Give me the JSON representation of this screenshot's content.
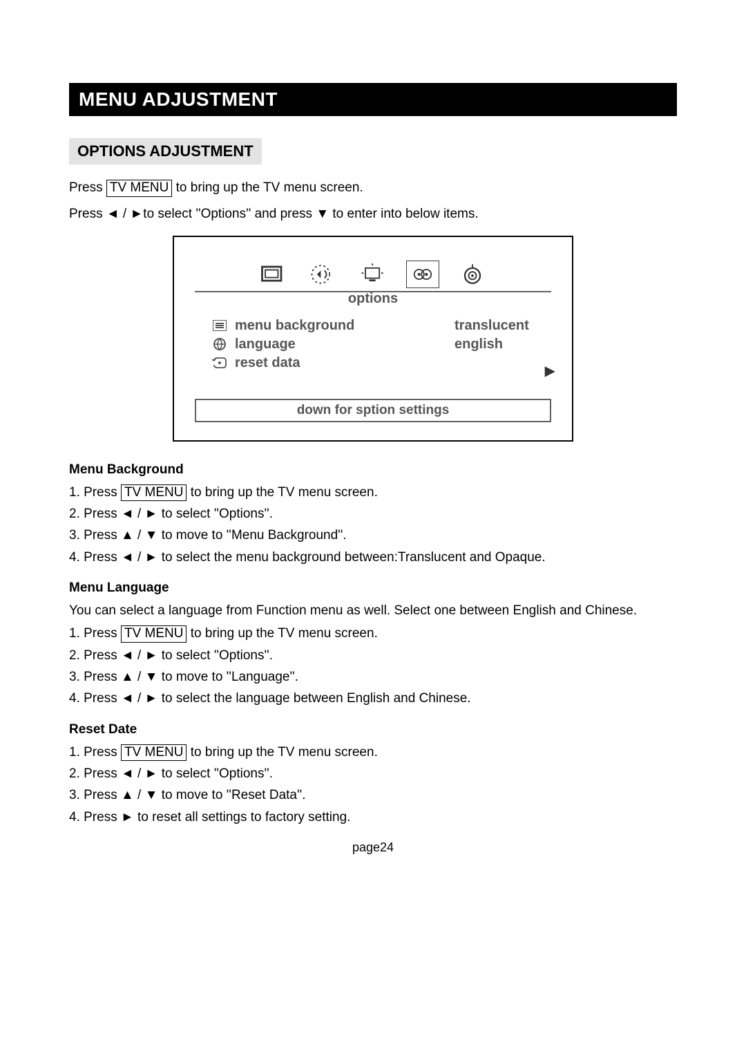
{
  "title": "MENU ADJUSTMENT",
  "subheading": "OPTIONS ADJUSTMENT",
  "intro": {
    "line1_a": "Press ",
    "line1_btn": "TV MENU",
    "line1_b": " to bring up the TV menu screen.",
    "line2": "Press ◄ / ►to select ''Options'' and press ▼  to enter into below items."
  },
  "screen": {
    "options_label": "options",
    "rows": [
      {
        "label": "menu background",
        "value": "translucent"
      },
      {
        "label": "language",
        "value": "english"
      },
      {
        "label": "reset data",
        "value": ""
      }
    ],
    "footer": "down for sption settings"
  },
  "sections": [
    {
      "title": "Menu Background",
      "paras": [],
      "steps": [
        {
          "pre": "1. Press ",
          "btn": "TV MENU",
          "post": " to bring up the TV menu screen."
        },
        {
          "text": "2. Press ◄ / ►  to select ''Options''."
        },
        {
          "text": "3. Press ▲ / ▼  to move to ''Menu Background''."
        },
        {
          "text": "4. Press ◄  / ►  to select the menu background between:Translucent and Opaque."
        }
      ]
    },
    {
      "title": "Menu Language",
      "paras": [
        "You can select a language from Function menu as well. Select one between English and Chinese."
      ],
      "steps": [
        {
          "pre": "1. Press ",
          "btn": "TV MENU",
          "post": " to bring up the TV menu screen."
        },
        {
          "text": "2. Press ◄ / ►  to select ''Options''."
        },
        {
          "text": "3. Press ▲ / ▼  to move to ''Language''."
        },
        {
          "text": "4. Press ◄  / ►  to select the language between English and Chinese."
        }
      ]
    },
    {
      "title": "Reset Date",
      "paras": [],
      "steps": [
        {
          "pre": "1. Press ",
          "btn": "TV MENU",
          "post": " to bring up the TV menu screen."
        },
        {
          "text": "2. Press ◄ / ►  to select ''Options''."
        },
        {
          "text": "3. Press ▲ / ▼  to move to ''Reset Data''."
        },
        {
          "text": "4. Press ►  to reset all settings to factory setting."
        }
      ]
    }
  ],
  "page_num": "page24"
}
